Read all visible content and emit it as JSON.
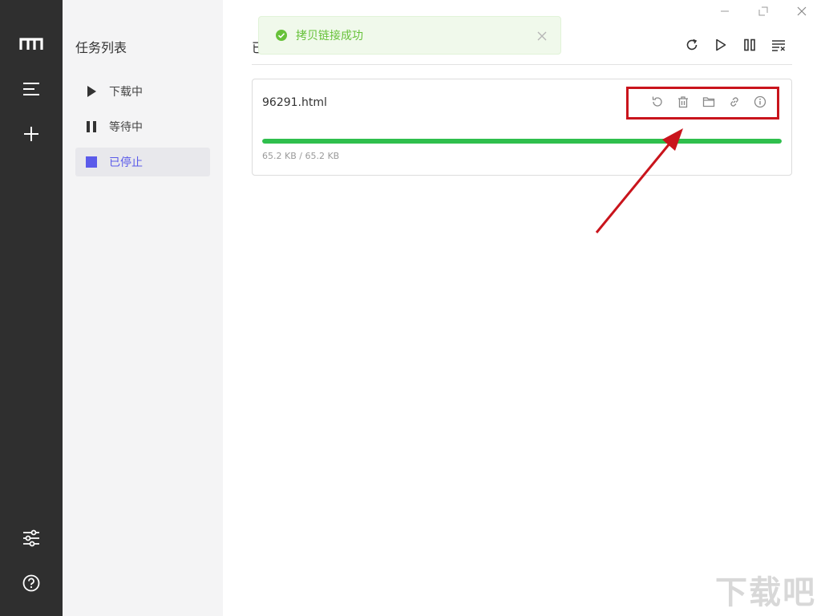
{
  "rail": {
    "items": [
      {
        "icon": "logo-m-icon"
      },
      {
        "icon": "menu-icon"
      },
      {
        "icon": "plus-icon"
      },
      {
        "icon": "sliders-icon"
      },
      {
        "icon": "help-icon"
      }
    ]
  },
  "tasklist": {
    "title": "任务列表",
    "items": [
      {
        "label": "下载中",
        "icon": "play-icon"
      },
      {
        "label": "等待中",
        "icon": "pause-icon"
      },
      {
        "label": "已停止",
        "icon": "stop-icon",
        "active": true
      }
    ]
  },
  "main": {
    "title_fragment": "已",
    "toast": {
      "message": "拷贝链接成功"
    },
    "task": {
      "file_name": "96291.html",
      "downloaded": "65.2 KB",
      "total": "65.2 KB",
      "separator": " / ",
      "progress": 1.0
    }
  },
  "watermark": "下载吧",
  "colors": {
    "accent": "#5b5bea",
    "progress": "#2fbf4d",
    "toast_text": "#67c23a",
    "annotation": "#c9141c"
  }
}
